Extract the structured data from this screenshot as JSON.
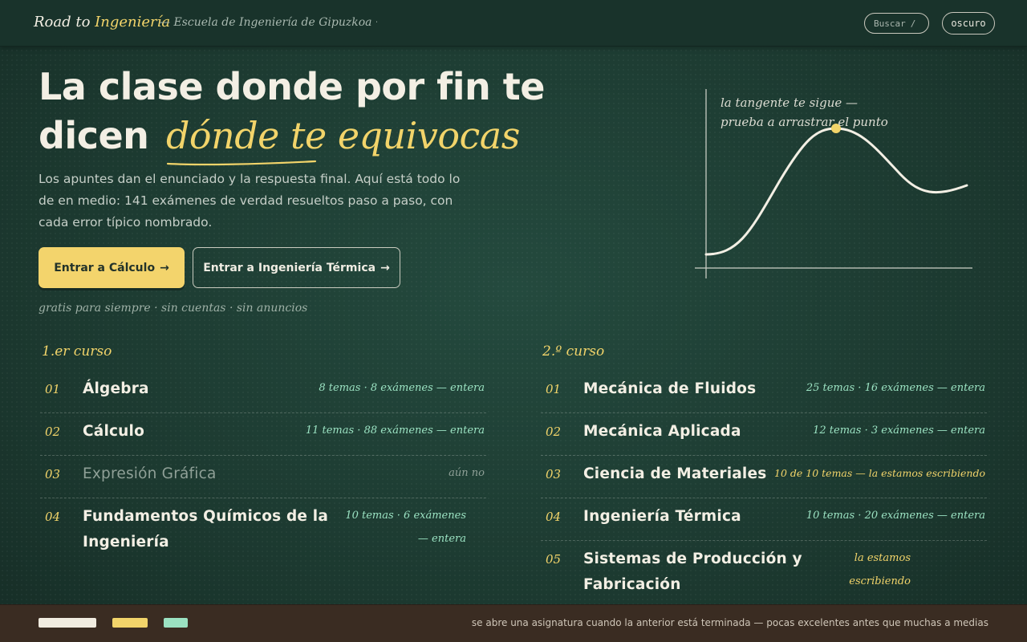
{
  "header": {
    "brand_prefix": "Road to",
    "brand_accent": "Ingeniería",
    "school": "— Escuela de Ingeniería de Gipuzkoa · UPV/EHU",
    "search_label": "Buscar",
    "search_shortcut": "/",
    "theme_label": "oscuro"
  },
  "hero": {
    "title_line1": "La clase donde por fin te",
    "title_line2_plain": "dicen",
    "title_line2_highlight": "dónde te equivocas",
    "lead": "Los apuntes dan el enunciado y la respuesta final. Aquí está todo lo de en medio: 141 exámenes de verdad resueltos paso a paso, con cada error típico nombrado.",
    "cta_primary": "Entrar a Cálculo",
    "cta_secondary": "Entrar a Ingeniería Térmica",
    "arrow": "→",
    "tagline": "gratis para siempre · sin cuentas · sin anuncios"
  },
  "figure": {
    "note_line1": "la tangente te sigue —",
    "note_line2": "prueba a arrastrar el punto"
  },
  "courses": {
    "year1": {
      "label": "1.er curso",
      "items": [
        {
          "num": "01",
          "name": "Álgebra",
          "meta": "8 temas · 8 exámenes — entera"
        },
        {
          "num": "02",
          "name": "Cálculo",
          "meta": "11 temas · 88 exámenes — entera"
        },
        {
          "num": "03",
          "name": "Expresión Gráfica",
          "meta": "aún no"
        },
        {
          "num": "04",
          "name": "Fundamentos Químicos de la Ingeniería",
          "meta": "10 temas · 6 exámenes — entera"
        }
      ]
    },
    "year2": {
      "label": "2.º curso",
      "items": [
        {
          "num": "01",
          "name": "Mecánica de Fluidos",
          "meta": "25 temas · 16 exámenes — entera"
        },
        {
          "num": "02",
          "name": "Mecánica Aplicada",
          "meta": "12 temas · 3 exámenes — entera"
        },
        {
          "num": "03",
          "name": "Ciencia de Materiales",
          "meta": "10 de 10 temas — la estamos escribiendo"
        },
        {
          "num": "04",
          "name": "Ingeniería Térmica",
          "meta": "10 temas · 20 exámenes — entera"
        },
        {
          "num": "05",
          "name": "Sistemas de Producción y Fabricación",
          "meta": "la estamos escribiendo"
        }
      ]
    }
  },
  "footer": {
    "note": "se abre una asignatura cuando la anterior está terminada — pocas excelentes antes que muchas a medias",
    "swatch_colors": [
      "#f1ece0",
      "#f2d46a",
      "#9be2c2"
    ]
  },
  "colors": {
    "chalkboard": "#1d3a31",
    "accent_yellow": "#f2d46a",
    "accent_mint": "#9be2c2",
    "footer_wood": "#3a2c22"
  }
}
